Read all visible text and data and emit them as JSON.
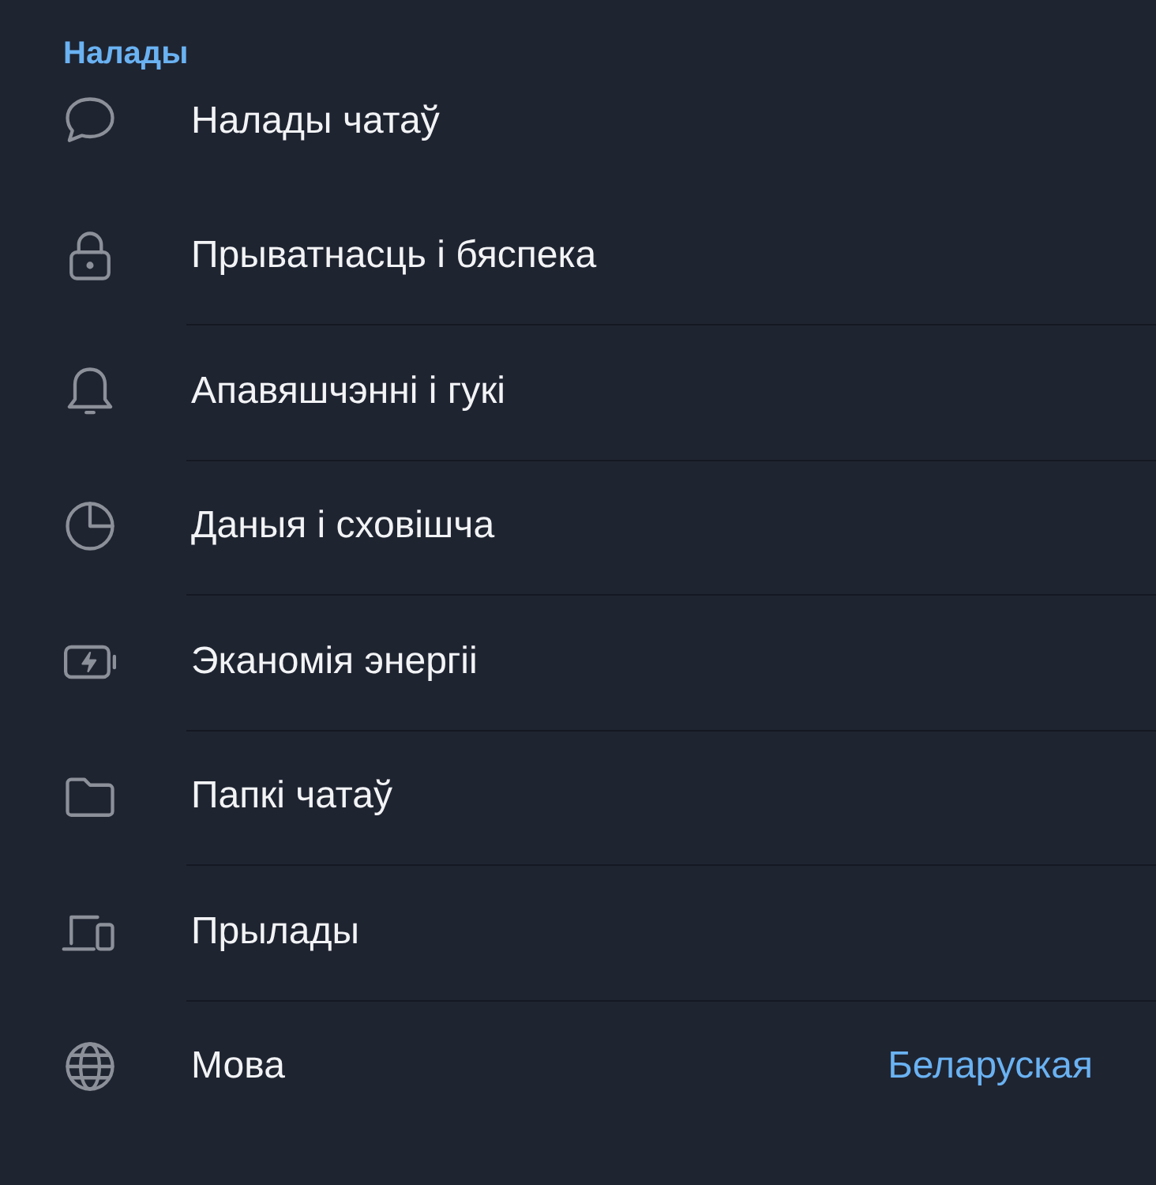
{
  "section": {
    "title": "Налады"
  },
  "items": [
    {
      "kind": "chat",
      "label": "Налады чатаў"
    },
    {
      "kind": "lock",
      "label": "Прыватнасць і бяспека"
    },
    {
      "kind": "bell",
      "label": "Апавяшчэнні і гукі"
    },
    {
      "kind": "pie",
      "label": "Даныя і сховішча"
    },
    {
      "kind": "battery",
      "label": "Эканомія энергіі"
    },
    {
      "kind": "folder",
      "label": "Папкі чатаў"
    },
    {
      "kind": "devices",
      "label": "Прылады"
    },
    {
      "kind": "globe",
      "label": "Мова",
      "value": "Беларуская"
    }
  ]
}
